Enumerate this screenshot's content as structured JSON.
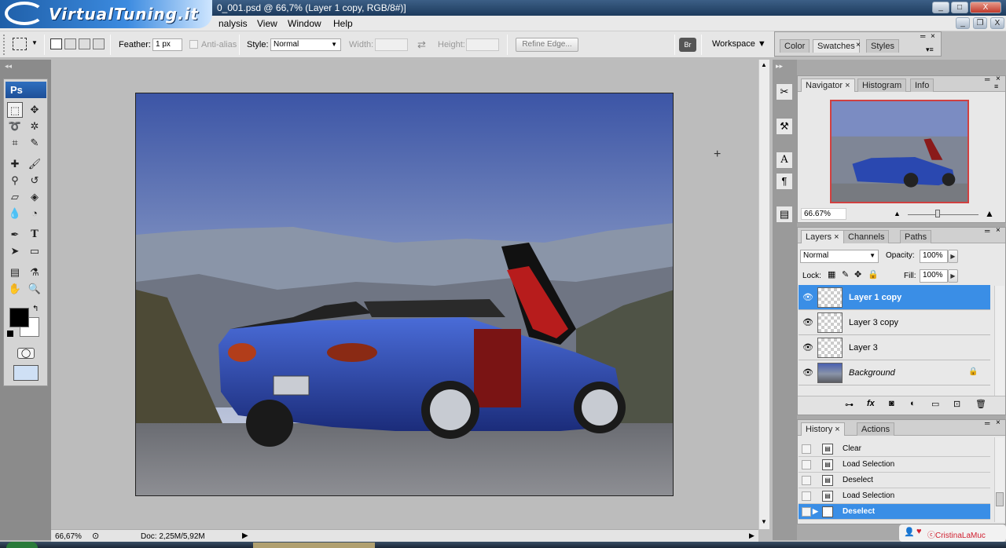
{
  "window": {
    "logo_text": "VirtualTuning.it",
    "title": "0_001.psd @ 66,7% (Layer 1 copy, RGB/8#)]",
    "controls": [
      "_",
      "□",
      "X"
    ],
    "doc_controls": [
      "_",
      "❐",
      "X"
    ]
  },
  "menu": {
    "items": [
      "nalysis",
      "View",
      "Window",
      "Help"
    ]
  },
  "options": {
    "feather_label": "Feather:",
    "feather_value": "1 px",
    "antialias_label": "Anti-alias",
    "style_label": "Style:",
    "style_value": "Normal",
    "width_label": "Width:",
    "height_label": "Height:",
    "refine_edge_label": "Refine Edge...",
    "workspace_label": "Workspace ▼"
  },
  "tools": {
    "ps_label": "Ps"
  },
  "status": {
    "zoom": "66,67%",
    "doc_info": "Doc: 2,25M/5,92M"
  },
  "color_panel": {
    "tabs": [
      "Color",
      "Swatches",
      "Styles"
    ]
  },
  "navigator_panel": {
    "tabs": [
      "Navigator",
      "Histogram",
      "Info"
    ],
    "zoom": "66.67%"
  },
  "layers_panel": {
    "tabs": [
      "Layers",
      "Channels",
      "Paths"
    ],
    "blend_mode": "Normal",
    "opacity_label": "Opacity:",
    "opacity_value": "100%",
    "lock_label": "Lock:",
    "fill_label": "Fill:",
    "fill_value": "100%",
    "layers": [
      {
        "name": "Layer 1 copy",
        "selected": true
      },
      {
        "name": "Layer 3 copy",
        "selected": false
      },
      {
        "name": "Layer 3",
        "selected": false
      },
      {
        "name": "Background",
        "selected": false
      }
    ]
  },
  "history_panel": {
    "tabs": [
      "History",
      "Actions"
    ],
    "items": [
      {
        "name": "Clear",
        "selected": false
      },
      {
        "name": "Load Selection",
        "selected": false
      },
      {
        "name": "Deselect",
        "selected": false
      },
      {
        "name": "Load Selection",
        "selected": false
      },
      {
        "name": "Deselect",
        "selected": true
      }
    ]
  },
  "watermark": {
    "text": "ⓒCristinaLaMuc"
  },
  "colors": {
    "accent": "#3a8ee6",
    "foreground": "#000000",
    "background": "#ffffff"
  }
}
